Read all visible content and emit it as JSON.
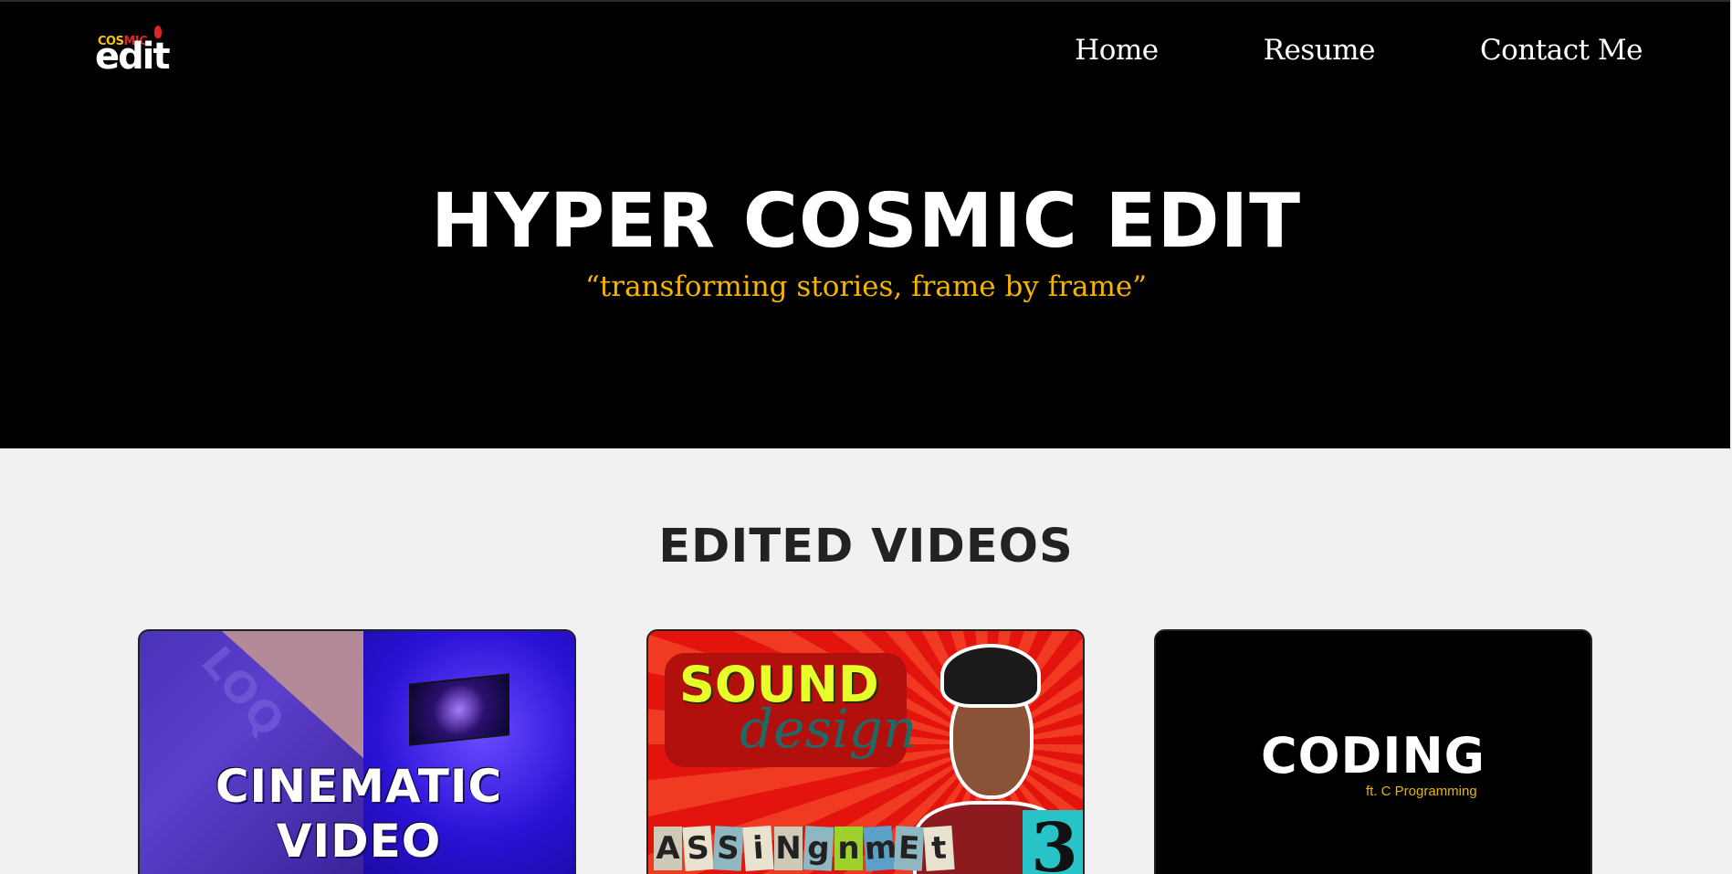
{
  "header": {
    "logo": {
      "top_text_1": "COS",
      "top_text_2": "MIC",
      "main_text": "edit"
    },
    "nav": [
      {
        "label": "Home"
      },
      {
        "label": "Resume"
      },
      {
        "label": "Contact Me"
      }
    ]
  },
  "hero": {
    "title": "HYPER COSMIC EDIT",
    "subtitle": "“transforming stories, frame by frame”"
  },
  "videos": {
    "section_title": "EDITED VIDEOS",
    "cards": [
      {
        "line1": "CINEMATIC",
        "line2": "VIDEO",
        "logo_text": "LOQ"
      },
      {
        "sound": "SOUND",
        "design": "design",
        "assignment_letters": [
          "A",
          "S",
          "S",
          "i",
          "N",
          "g",
          "n",
          "m",
          "E",
          "t"
        ],
        "number": "3"
      },
      {
        "title": "CODING",
        "subtitle": "ft. C Programming"
      }
    ]
  },
  "colors": {
    "header_bg": "#000000",
    "page_bg": "#f1f1f1",
    "accent_yellow": "#f4b400",
    "title_white": "#ffffff",
    "section_title": "#222222"
  }
}
